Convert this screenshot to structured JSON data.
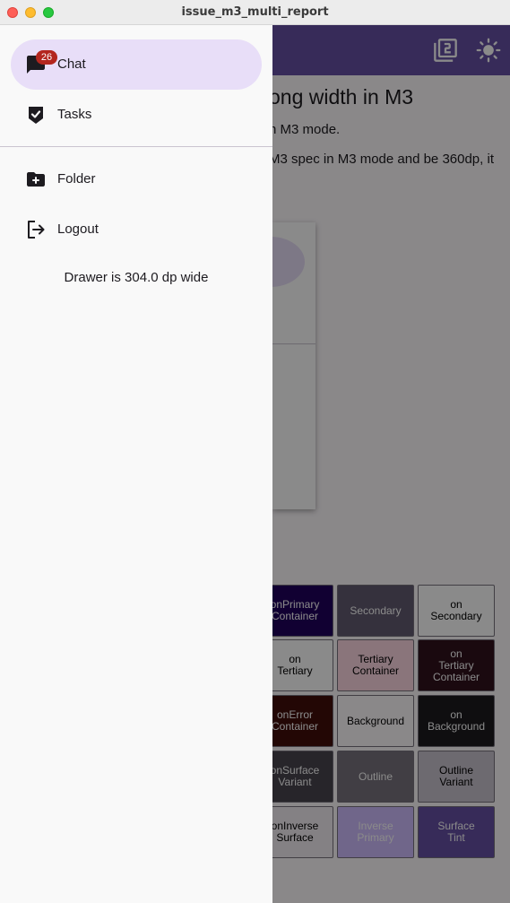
{
  "window": {
    "title": "issue_m3_multi_report"
  },
  "content": {
    "title": "ong width in M3",
    "line1": "n M3 mode.",
    "line2": "M3 spec in M3 mode and be 360dp, it"
  },
  "appbar": {
    "icons": [
      "filter-2-icon",
      "brightness-icon"
    ]
  },
  "swatches": [
    {
      "label": "onPrimary\nContainer",
      "bg": "#21005d",
      "fg": "#ffffff"
    },
    {
      "label": "Secondary",
      "bg": "#625b71",
      "fg": "#ffffff"
    },
    {
      "label": "on\nSecondary",
      "bg": "#ffffff",
      "fg": "#000000"
    },
    {
      "label": "on\nTertiary",
      "bg": "#ffffff",
      "fg": "#000000"
    },
    {
      "label": "Tertiary\nContainer",
      "bg": "#ffd8e4",
      "fg": "#000000"
    },
    {
      "label": "on\nTertiary\nContainer",
      "bg": "#31111d",
      "fg": "#ffffff"
    },
    {
      "label": "onError\nContainer",
      "bg": "#410e0b",
      "fg": "#ffffff"
    },
    {
      "label": "Background",
      "bg": "#fffbfe",
      "fg": "#000000"
    },
    {
      "label": "on\nBackground",
      "bg": "#1c1b1f",
      "fg": "#ffffff"
    },
    {
      "label": "onSurface\nVariant",
      "bg": "#49454f",
      "fg": "#ffffff"
    },
    {
      "label": "Outline",
      "bg": "#79747e",
      "fg": "#ffffff"
    },
    {
      "label": "Outline\nVariant",
      "bg": "#cac4d0",
      "fg": "#000000"
    },
    {
      "label": "onInverse\nSurface",
      "bg": "#f4eff4",
      "fg": "#000000"
    },
    {
      "label": "Inverse\nPrimary",
      "bg": "#d0bcff",
      "fg": "#ffffff"
    },
    {
      "label": "Surface\nTint",
      "bg": "#6750a4",
      "fg": "#ffffff"
    }
  ],
  "drawer": {
    "items": [
      {
        "label": "Chat",
        "icon": "chat-icon",
        "badge": "26",
        "selected": true
      },
      {
        "label": "Tasks",
        "icon": "task-check-icon",
        "selected": false
      },
      {
        "label": "Folder",
        "icon": "folder-add-icon",
        "selected": false
      },
      {
        "label": "Logout",
        "icon": "logout-icon",
        "selected": false
      }
    ],
    "width_text": "Drawer is 304.0 dp wide"
  },
  "colors": {
    "primary": "#6750a4",
    "selected_indicator": "#e8def8",
    "badge": "#b3261e",
    "drawer_bg": "#f9f9f9"
  }
}
